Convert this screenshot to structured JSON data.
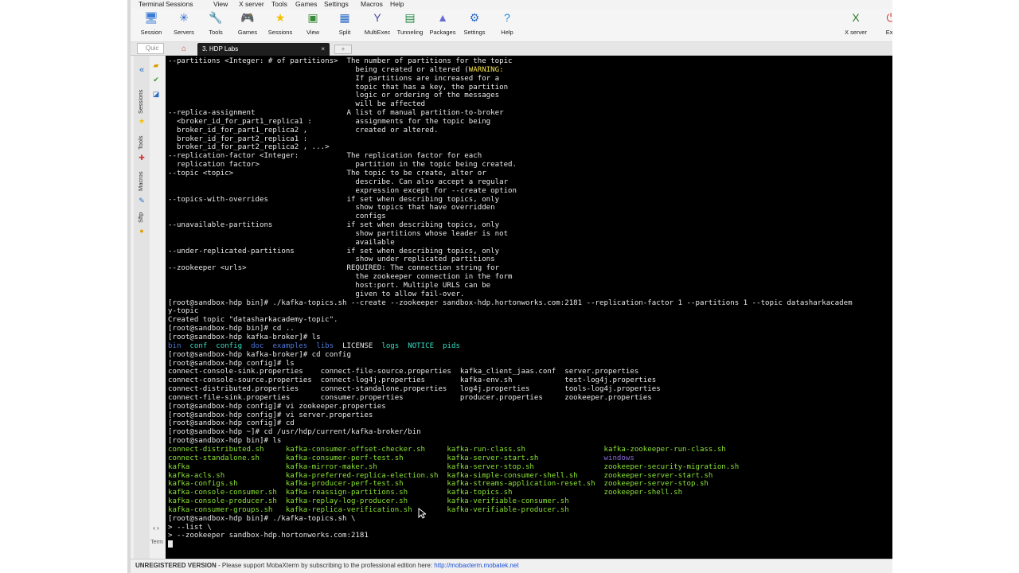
{
  "menu": [
    "Terminal",
    "Sessions",
    "View",
    "X server",
    "Tools",
    "Games",
    "Settings",
    "Macros",
    "Help"
  ],
  "toolbar": [
    {
      "label": "Session",
      "icon": "session-icon",
      "glyph": "🖥",
      "color": "#3a7bd5"
    },
    {
      "label": "Servers",
      "icon": "servers-icon",
      "glyph": "✳",
      "color": "#2a6bc5"
    },
    {
      "label": "Tools",
      "icon": "tools-icon",
      "glyph": "🔧",
      "color": "#d23232"
    },
    {
      "label": "Games",
      "icon": "games-icon",
      "glyph": "🎮",
      "color": "#555555"
    },
    {
      "label": "Sessions",
      "icon": "star-icon",
      "glyph": "★",
      "color": "#f2c200"
    },
    {
      "label": "View",
      "icon": "view-icon",
      "glyph": "▣",
      "color": "#3a8a3a"
    },
    {
      "label": "Split",
      "icon": "split-icon",
      "glyph": "▦",
      "color": "#2a6bc5"
    },
    {
      "label": "MultiExec",
      "icon": "multiexec-icon",
      "glyph": "Y",
      "color": "#4a4aa5"
    },
    {
      "label": "Tunneling",
      "icon": "tunneling-icon",
      "glyph": "▤",
      "color": "#2a8a4a"
    },
    {
      "label": "Packages",
      "icon": "packages-icon",
      "glyph": "▲",
      "color": "#6a6ad5"
    },
    {
      "label": "Settings",
      "icon": "settings-icon",
      "glyph": "⚙",
      "color": "#2a6bc5"
    },
    {
      "label": "Help",
      "icon": "help-icon",
      "glyph": "?",
      "color": "#1a8ae2"
    },
    {
      "label": "X server",
      "icon": "xserver-icon",
      "glyph": "X",
      "color": "#2a7a2a"
    },
    {
      "label": "Exit",
      "icon": "exit-icon",
      "glyph": "⏻",
      "color": "#d23232"
    }
  ],
  "tabs": {
    "quick_connect": "Quic",
    "home_glyph": "⌂",
    "active_label": "3. HDP Labs",
    "close_glyph": "×",
    "new_tab_glyph": "+"
  },
  "sidebar": {
    "sessions": "Sessions",
    "tools": "Tools",
    "macros": "Macros",
    "sftp": "Sftp",
    "collapse": "«",
    "nav": "‹ ›",
    "term": "Term"
  },
  "terminal": {
    "lines": [
      [
        {
          "t": "--partitions <Integer: # of partitions>  The number of partitions for the topic"
        }
      ],
      [
        {
          "t": "                                           being created or altered ("
        },
        {
          "t": "WARNING:",
          "c": "y"
        }
      ],
      [
        {
          "t": "                                           If partitions are increased for a"
        }
      ],
      [
        {
          "t": "                                           topic that has a key, the partition"
        }
      ],
      [
        {
          "t": "                                           logic or ordering of the messages"
        }
      ],
      [
        {
          "t": "                                           will be affected"
        }
      ],
      [
        {
          "t": "--replica-assignment                     A list of manual partition-to-broker"
        }
      ],
      [
        {
          "t": "  <broker_id_for_part1_replica1 :          assignments for the topic being"
        }
      ],
      [
        {
          "t": "  broker_id_for_part1_replica2 ,           created or altered."
        }
      ],
      [
        {
          "t": "  broker_id_for_part2_replica1 :"
        }
      ],
      [
        {
          "t": "  broker_id_for_part2_replica2 , ...>"
        }
      ],
      [
        {
          "t": "--replication-factor <Integer:           The replication factor for each"
        }
      ],
      [
        {
          "t": "  replication factor>                      partition in the topic being created."
        }
      ],
      [
        {
          "t": "--topic <topic>                          The topic to be create, alter or"
        }
      ],
      [
        {
          "t": "                                           describe. Can also accept a regular"
        }
      ],
      [
        {
          "t": "                                           expression except for --create option"
        }
      ],
      [
        {
          "t": "--topics-with-overrides                  if set when describing topics, only"
        }
      ],
      [
        {
          "t": "                                           show topics that have overridden"
        }
      ],
      [
        {
          "t": "                                           configs"
        }
      ],
      [
        {
          "t": "--unavailable-partitions                 if set when describing topics, only"
        }
      ],
      [
        {
          "t": "                                           show partitions whose leader is not"
        }
      ],
      [
        {
          "t": "                                           available"
        }
      ],
      [
        {
          "t": "--under-replicated-partitions            if set when describing topics, only"
        }
      ],
      [
        {
          "t": "                                           show under replicated partitions"
        }
      ],
      [
        {
          "t": "--zookeeper <urls>                       REQUIRED: The connection string for"
        }
      ],
      [
        {
          "t": "                                           the zookeeper connection in the form"
        }
      ],
      [
        {
          "t": "                                           host:port. Multiple URLS can be"
        }
      ],
      [
        {
          "t": "                                           given to allow fail-over."
        }
      ],
      [
        {
          "t": "[root@sandbox-hdp bin]# ./kafka-topics.sh --create --zookeeper sandbox-hdp.hortonworks.com:2181 --replication-factor 1 --partitions 1 --topic datasharkacadem"
        }
      ],
      [
        {
          "t": "y-topic"
        }
      ],
      [
        {
          "t": "Created topic \"datasharkacademy-topic\"."
        }
      ],
      [
        {
          "t": "[root@sandbox-hdp bin]# cd .."
        }
      ],
      [
        {
          "t": "[root@sandbox-hdp kafka-broker]# ls"
        }
      ],
      [
        {
          "t": "bin",
          "c": "b"
        },
        {
          "t": "  "
        },
        {
          "t": "conf",
          "c": "c"
        },
        {
          "t": "  "
        },
        {
          "t": "config",
          "c": "c"
        },
        {
          "t": "  "
        },
        {
          "t": "doc",
          "c": "b"
        },
        {
          "t": "  "
        },
        {
          "t": "examples",
          "c": "b"
        },
        {
          "t": "  "
        },
        {
          "t": "libs",
          "c": "b"
        },
        {
          "t": "  LICENSE  "
        },
        {
          "t": "logs",
          "c": "c"
        },
        {
          "t": "  "
        },
        {
          "t": "NOTICE",
          "c": "c"
        },
        {
          "t": "  "
        },
        {
          "t": "pids",
          "c": "c"
        }
      ],
      [
        {
          "t": "[root@sandbox-hdp kafka-broker]# cd config"
        }
      ],
      [
        {
          "t": "[root@sandbox-hdp config]# ls"
        }
      ],
      [
        {
          "t": "connect-console-sink.properties    connect-file-source.properties  kafka_client_jaas.conf  server.properties"
        }
      ],
      [
        {
          "t": "connect-console-source.properties  connect-log4j.properties        kafka-env.sh            test-log4j.properties"
        }
      ],
      [
        {
          "t": "connect-distributed.properties     connect-standalone.properties   log4j.properties        tools-log4j.properties"
        }
      ],
      [
        {
          "t": "connect-file-sink.properties       consumer.properties             producer.properties     zookeeper.properties"
        }
      ],
      [
        {
          "t": "[root@sandbox-hdp config]# vi zookeeper.properties"
        }
      ],
      [
        {
          "t": "[root@sandbox-hdp config]# vi server.properties"
        }
      ],
      [
        {
          "t": "[root@sandbox-hdp config]# cd"
        }
      ],
      [
        {
          "t": "[root@sandbox-hdp ~]# cd /usr/hdp/current/kafka-broker/bin"
        }
      ],
      [
        {
          "t": "[root@sandbox-hdp bin]# ls"
        }
      ],
      [
        {
          "t": "connect-distributed.sh     kafka-consumer-offset-checker.sh     kafka-run-class.sh                  kafka-zookeeper-run-class.sh",
          "c": "g"
        }
      ],
      [
        {
          "t": "connect-standalone.sh      kafka-consumer-perf-test.sh          kafka-server-start.sh               ",
          "c": "g"
        },
        {
          "t": "windows",
          "c": "p"
        }
      ],
      [
        {
          "t": "kafka                      kafka-mirror-maker.sh                kafka-server-stop.sh                zookeeper-security-migration.sh",
          "c": "g"
        }
      ],
      [
        {
          "t": "kafka-acls.sh              kafka-preferred-replica-election.sh  kafka-simple-consumer-shell.sh      zookeeper-server-start.sh",
          "c": "g"
        }
      ],
      [
        {
          "t": "kafka-configs.sh           kafka-producer-perf-test.sh          kafka-streams-application-reset.sh  zookeeper-server-stop.sh",
          "c": "g"
        }
      ],
      [
        {
          "t": "kafka-console-consumer.sh  kafka-reassign-partitions.sh         kafka-topics.sh                     zookeeper-shell.sh",
          "c": "g"
        }
      ],
      [
        {
          "t": "kafka-console-producer.sh  kafka-replay-log-producer.sh         kafka-verifiable-consumer.sh",
          "c": "g"
        }
      ],
      [
        {
          "t": "kafka-consumer-groups.sh   kafka-replica-verification.sh        kafka-verifiable-producer.sh",
          "c": "g"
        }
      ],
      [
        {
          "t": "[root@sandbox-hdp bin]# ./kafka-topics.sh \\"
        }
      ],
      [
        {
          "t": "> --list \\"
        }
      ],
      [
        {
          "t": "> --zookeeper sandbox-hdp.hortonworks.com:2181"
        }
      ]
    ]
  },
  "status": {
    "unregistered": "UNREGISTERED VERSION",
    "message": "  -  Please support MobaXterm by subscribing to the professional edition here:  ",
    "link": "http://mobaxterm.mobatek.net"
  }
}
